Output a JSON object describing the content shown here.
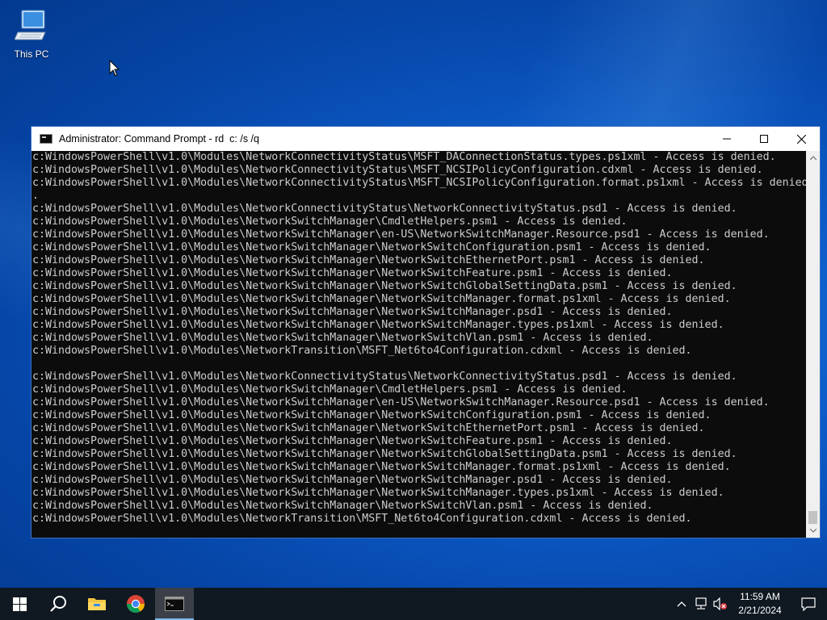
{
  "desktop": {
    "icons": [
      {
        "label": "This PC",
        "icon": "computer-icon"
      }
    ]
  },
  "window": {
    "title": "Administrator: Command Prompt - rd  c: /s /q",
    "controls": [
      "minimize",
      "maximize",
      "close"
    ],
    "console_lines": [
      "c:WindowsPowerShell\\v1.0\\Modules\\NetworkConnectivityStatus\\MSFT_DAConnectionStatus.types.ps1xml - Access is denied.",
      "c:WindowsPowerShell\\v1.0\\Modules\\NetworkConnectivityStatus\\MSFT_NCSIPolicyConfiguration.cdxml - Access is denied.",
      "c:WindowsPowerShell\\v1.0\\Modules\\NetworkConnectivityStatus\\MSFT_NCSIPolicyConfiguration.format.ps1xml - Access is denied",
      ".",
      "c:WindowsPowerShell\\v1.0\\Modules\\NetworkConnectivityStatus\\NetworkConnectivityStatus.psd1 - Access is denied.",
      "c:WindowsPowerShell\\v1.0\\Modules\\NetworkSwitchManager\\CmdletHelpers.psm1 - Access is denied.",
      "c:WindowsPowerShell\\v1.0\\Modules\\NetworkSwitchManager\\en-US\\NetworkSwitchManager.Resource.psd1 - Access is denied.",
      "c:WindowsPowerShell\\v1.0\\Modules\\NetworkSwitchManager\\NetworkSwitchConfiguration.psm1 - Access is denied.",
      "c:WindowsPowerShell\\v1.0\\Modules\\NetworkSwitchManager\\NetworkSwitchEthernetPort.psm1 - Access is denied.",
      "c:WindowsPowerShell\\v1.0\\Modules\\NetworkSwitchManager\\NetworkSwitchFeature.psm1 - Access is denied.",
      "c:WindowsPowerShell\\v1.0\\Modules\\NetworkSwitchManager\\NetworkSwitchGlobalSettingData.psm1 - Access is denied.",
      "c:WindowsPowerShell\\v1.0\\Modules\\NetworkSwitchManager\\NetworkSwitchManager.format.ps1xml - Access is denied.",
      "c:WindowsPowerShell\\v1.0\\Modules\\NetworkSwitchManager\\NetworkSwitchManager.psd1 - Access is denied.",
      "c:WindowsPowerShell\\v1.0\\Modules\\NetworkSwitchManager\\NetworkSwitchManager.types.ps1xml - Access is denied.",
      "c:WindowsPowerShell\\v1.0\\Modules\\NetworkSwitchManager\\NetworkSwitchVlan.psm1 - Access is denied.",
      "c:WindowsPowerShell\\v1.0\\Modules\\NetworkTransition\\MSFT_Net6to4Configuration.cdxml - Access is denied.",
      "",
      "c:WindowsPowerShell\\v1.0\\Modules\\NetworkConnectivityStatus\\NetworkConnectivityStatus.psd1 - Access is denied.",
      "c:WindowsPowerShell\\v1.0\\Modules\\NetworkSwitchManager\\CmdletHelpers.psm1 - Access is denied.",
      "c:WindowsPowerShell\\v1.0\\Modules\\NetworkSwitchManager\\en-US\\NetworkSwitchManager.Resource.psd1 - Access is denied.",
      "c:WindowsPowerShell\\v1.0\\Modules\\NetworkSwitchManager\\NetworkSwitchConfiguration.psm1 - Access is denied.",
      "c:WindowsPowerShell\\v1.0\\Modules\\NetworkSwitchManager\\NetworkSwitchEthernetPort.psm1 - Access is denied.",
      "c:WindowsPowerShell\\v1.0\\Modules\\NetworkSwitchManager\\NetworkSwitchFeature.psm1 - Access is denied.",
      "c:WindowsPowerShell\\v1.0\\Modules\\NetworkSwitchManager\\NetworkSwitchGlobalSettingData.psm1 - Access is denied.",
      "c:WindowsPowerShell\\v1.0\\Modules\\NetworkSwitchManager\\NetworkSwitchManager.format.ps1xml - Access is denied.",
      "c:WindowsPowerShell\\v1.0\\Modules\\NetworkSwitchManager\\NetworkSwitchManager.psd1 - Access is denied.",
      "c:WindowsPowerShell\\v1.0\\Modules\\NetworkSwitchManager\\NetworkSwitchManager.types.ps1xml - Access is denied.",
      "c:WindowsPowerShell\\v1.0\\Modules\\NetworkSwitchManager\\NetworkSwitchVlan.psm1 - Access is denied.",
      "c:WindowsPowerShell\\v1.0\\Modules\\NetworkTransition\\MSFT_Net6to4Configuration.cdxml - Access is denied."
    ]
  },
  "taskbar": {
    "pinned": [
      {
        "name": "start-button",
        "icon": "windows-logo-icon"
      },
      {
        "name": "search-button",
        "icon": "search-icon"
      },
      {
        "name": "file-explorer-button",
        "icon": "folder-icon"
      },
      {
        "name": "chrome-button",
        "icon": "chrome-icon"
      },
      {
        "name": "command-prompt-button",
        "icon": "terminal-icon",
        "active": true
      }
    ],
    "tray": {
      "icons": [
        "chevron-up-icon",
        "network-icon",
        "volume-muted-icon"
      ],
      "time": "11:59 AM",
      "date": "2/21/2024",
      "notification_icon": "notification-icon"
    }
  },
  "colors": {
    "console_bg": "#0c0c0c",
    "console_fg": "#cccccc",
    "taskbar_bg": "#101821",
    "accent": "#76b9ed"
  }
}
